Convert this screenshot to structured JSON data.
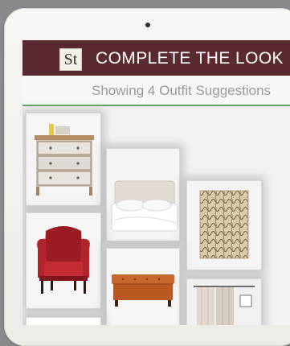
{
  "header": {
    "logo_text": "St",
    "title": "COMPLETE THE LOOK"
  },
  "subheader": {
    "text": "Showing 4 Outfit Suggestions"
  },
  "products": [
    {
      "name": "dresser",
      "icon": "dresser-image"
    },
    {
      "name": "upholstered-bed",
      "icon": "bed-image"
    },
    {
      "name": "area-rug",
      "icon": "rug-image"
    },
    {
      "name": "red-wingback-armchair",
      "icon": "armchair-image"
    },
    {
      "name": "leather-storage-bench",
      "icon": "bench-image"
    },
    {
      "name": "window-curtains",
      "icon": "curtains-image"
    }
  ]
}
